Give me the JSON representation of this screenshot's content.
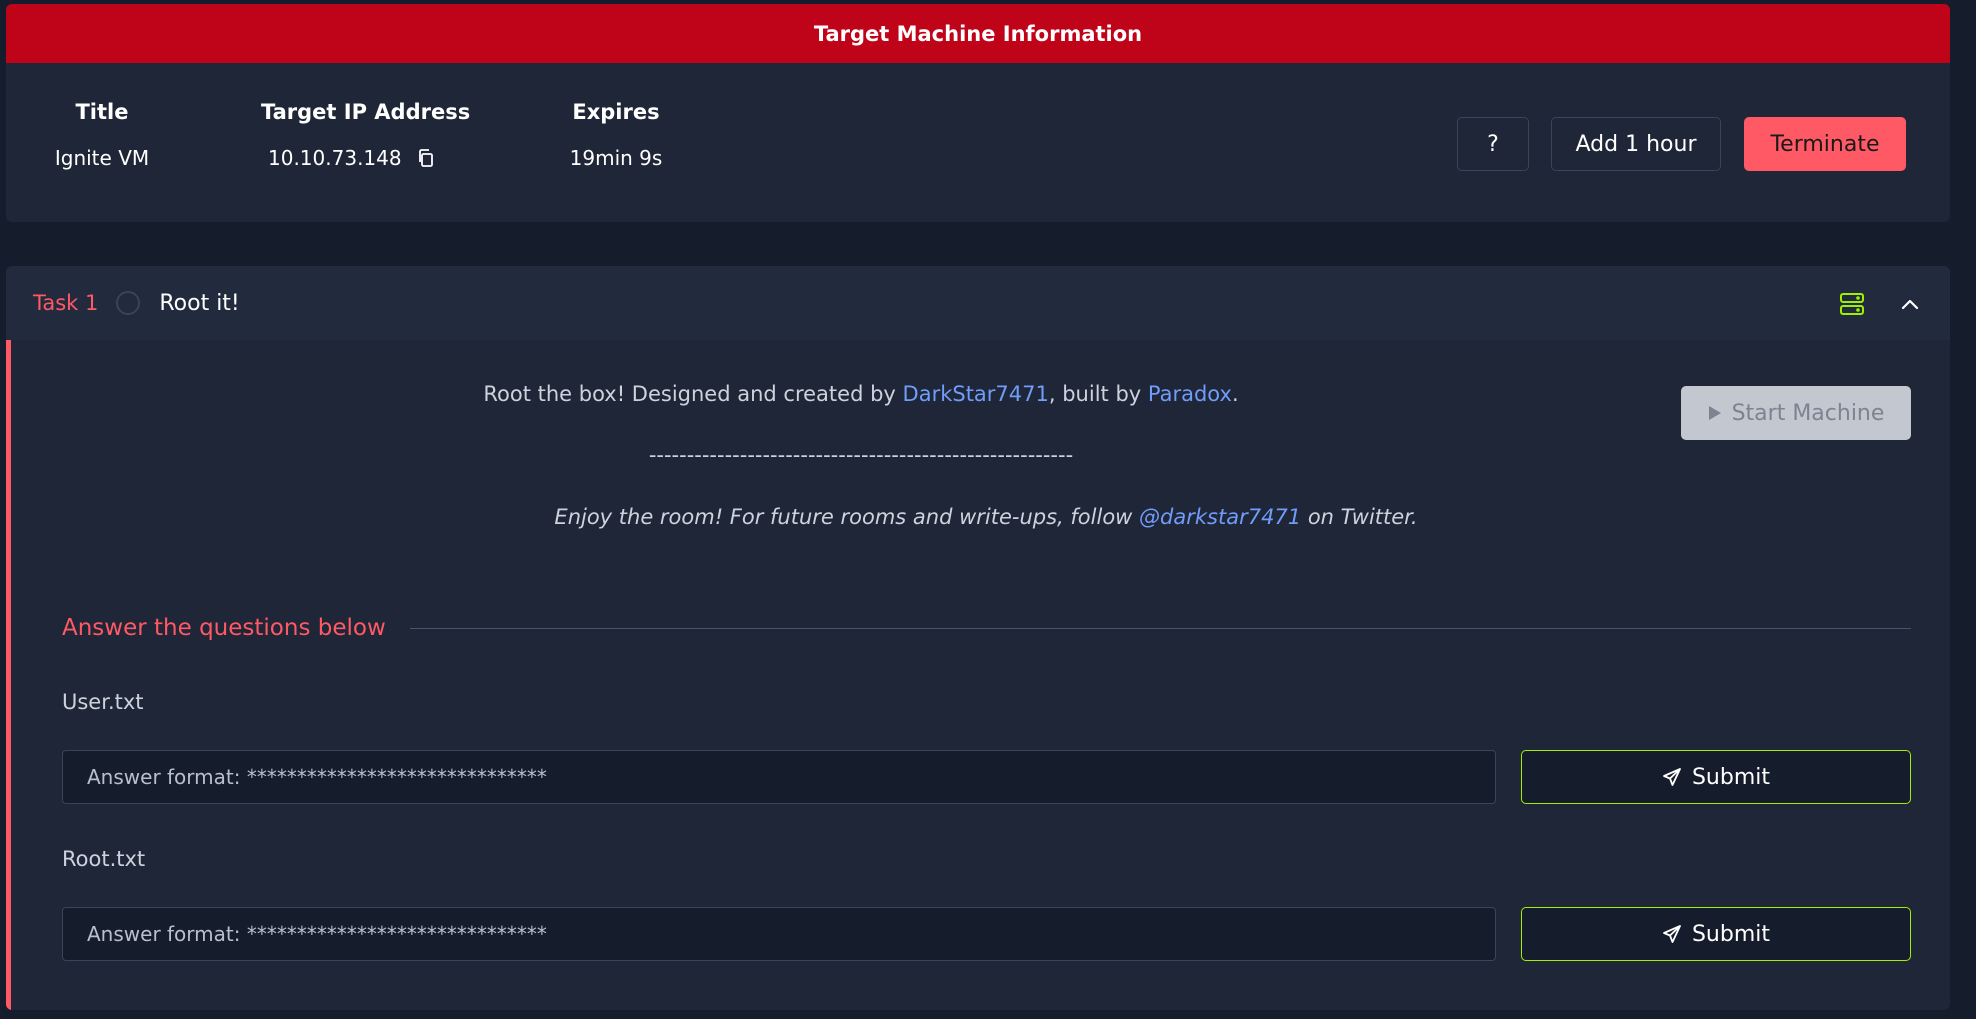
{
  "target_machine": {
    "header": "Target Machine Information",
    "title_label": "Title",
    "title_value": "Ignite VM",
    "ip_label": "Target IP Address",
    "ip_value": "10.10.73.148",
    "expires_label": "Expires",
    "expires_value": "19min 9s",
    "help_button": "?",
    "add_hour_button": "Add 1 hour",
    "terminate_button": "Terminate"
  },
  "task": {
    "number": "Task 1",
    "title": "Root it!",
    "start_machine_button": "Start Machine",
    "description": {
      "line1_prefix": "Root the box! Designed and created by ",
      "line1_link1": "DarkStar7471",
      "line1_middle": ", built by ",
      "line1_link2": "Paradox",
      "line1_suffix": ".",
      "dashes": "--------------------------------------------------------",
      "line3_prefix": "Enjoy the room! For future rooms and write-ups, follow ",
      "line3_link": "@darkstar7471",
      "line3_suffix": " on Twitter."
    },
    "answer_header": "Answer the questions below",
    "questions": [
      {
        "label": "User.txt",
        "placeholder": "Answer format: ******************************",
        "submit_label": "Submit"
      },
      {
        "label": "Root.txt",
        "placeholder": "Answer format: ******************************",
        "submit_label": "Submit"
      }
    ]
  },
  "colors": {
    "header_red": "#bf0319",
    "accent_red": "#ff5965",
    "link_blue": "#719cf9",
    "submit_green": "#9fef00"
  }
}
